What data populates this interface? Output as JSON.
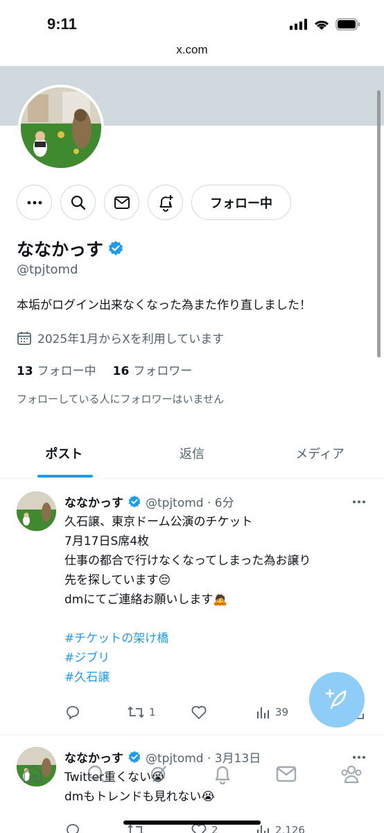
{
  "status_bar": {
    "time": "9:11"
  },
  "browser": {
    "url": "x.com"
  },
  "profile": {
    "display_name": "ななかっす",
    "handle": "@tpjtomd",
    "bio": "本垢がログイン出来なくなった為また作り直しました！",
    "joined": "2025年1月からXを利用しています",
    "following_count": "13",
    "following_label": "フォロー中",
    "followers_count": "16",
    "followers_label": "フォロワー",
    "no_followers_note": "フォローしている人にフォロワーはいません",
    "follow_button": "フォロー中"
  },
  "tabs": [
    {
      "label": "ポスト",
      "active": true
    },
    {
      "label": "返信",
      "active": false
    },
    {
      "label": "メディア",
      "active": false
    }
  ],
  "posts": [
    {
      "name": "ななかっす",
      "meta": "@tpjtomd · 6分",
      "lines": [
        "久石譲、東京ドーム公演のチケット",
        "7月17日S席4枚",
        "仕事の都合で行けなくなってしまった為お譲り",
        "先を探しています😔",
        "dmにてご連絡お願いします🙇"
      ],
      "hashtags": [
        "#チケットの架け橋",
        "#ジブリ",
        "#久石譲"
      ],
      "retweets": "1",
      "views": "39"
    },
    {
      "name": "ななかっす",
      "meta": "@tpjtomd · 3月13日",
      "lines": [
        "Twitter重くない😭",
        "dmもトレンドも見れない😭"
      ],
      "likes": "2",
      "views": "2,126"
    }
  ],
  "colors": {
    "accent": "#1d9bf0",
    "secondary_text": "#536471",
    "banner": "#cfd9de"
  }
}
